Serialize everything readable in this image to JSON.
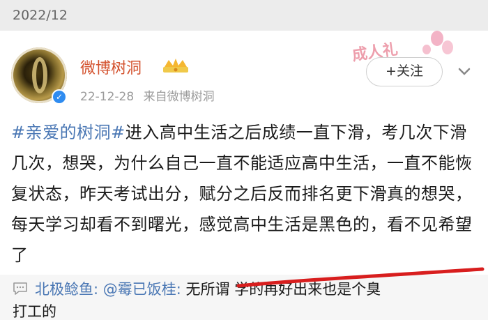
{
  "header": {
    "date": "2022/12"
  },
  "post": {
    "user_name": "微博树洞",
    "date": "22-12-28",
    "source": "来自微博树洞",
    "follow_label": "+关注",
    "sticker_text": "成人礼",
    "hashtag": "#亲爱的树洞#",
    "body": "进入高中生活之后成绩一直下滑，考几次下滑几次，想哭，为什么自己一直不能适应高中生活，一直不能恢复状态，昨天考试出分，赋分之后反而排名更下滑真的想哭，每天学习却看不到曙光，感觉高中生活是黑色的，看不见希望了"
  },
  "comment": {
    "author": "北极鲶鱼:",
    "mention": "@霉已饭桂:",
    "text_line1": " 无所谓 学的再好出来也是个臭",
    "text_line2": "打工的"
  },
  "colors": {
    "name": "#d4532f",
    "link": "#4a77b4",
    "underline": "#d81e1e"
  }
}
